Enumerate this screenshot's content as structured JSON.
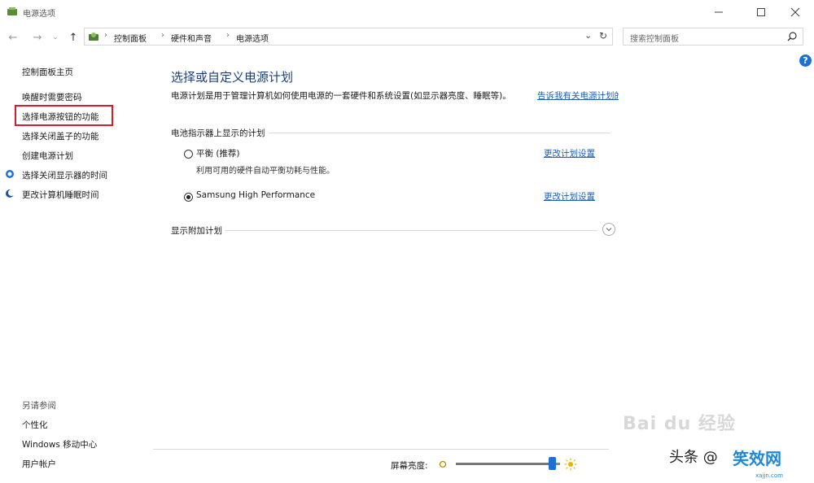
{
  "window": {
    "title": "电源选项",
    "minimize_icon": "minimize-icon",
    "maximize_icon": "maximize-icon",
    "close_icon": "close-icon"
  },
  "address": {
    "crumbs": [
      "控制面板",
      "硬件和声音",
      "电源选项"
    ],
    "search_placeholder": "搜索控制面板"
  },
  "sidebar": {
    "home": "控制面板主页",
    "links": [
      "唤醒时需要密码",
      "选择电源按钮的功能",
      "选择关闭盖子的功能",
      "创建电源计划",
      "选择关闭显示器的时间",
      "更改计算机睡眠时间"
    ],
    "see_also_title": "另请参阅",
    "see_also": [
      "个性化",
      "Windows 移动中心",
      "用户帐户"
    ]
  },
  "main": {
    "title": "选择或自定义电源计划",
    "description": "电源计划是用于管理计算机如何使用电源的一套硬件和系统设置(如显示器亮度、睡眠等)。",
    "learn_more": "告诉我有关电源计划的更多信息",
    "section_label": "电池指示器上显示的计划",
    "plans": [
      {
        "name": "平衡 (推荐)",
        "description": "利用可用的硬件自动平衡功耗与性能。",
        "change_link": "更改计划设置",
        "selected": false
      },
      {
        "name": "Samsung High Performance",
        "description": "",
        "change_link": "更改计划设置",
        "selected": true
      }
    ],
    "more_plans_label": "显示附加计划"
  },
  "brightness": {
    "label": "屏幕亮度:",
    "level_percent": 92
  },
  "watermark": {
    "baidu": "Bai du 经验",
    "toutiao": "头条 @",
    "brand": "笑效网",
    "url": "xajjn.com"
  },
  "colors": {
    "accent": "#1e6fd6",
    "title": "#1b3f78",
    "link": "#1a5fb4",
    "highlight_box": "#d61e2b"
  }
}
